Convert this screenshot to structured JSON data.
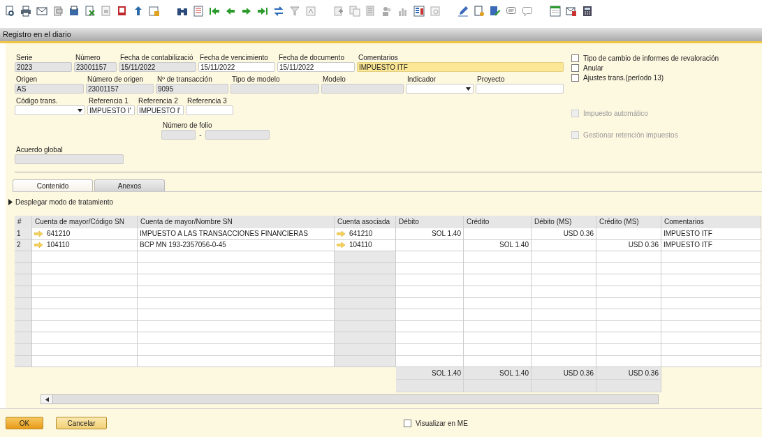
{
  "window": {
    "title": "Registro en el diario"
  },
  "header_rows": [
    [
      {
        "label": "Serie",
        "value": "2023",
        "kind": "readonly"
      },
      {
        "label": "Número",
        "value": "23001157",
        "kind": "readonly"
      },
      {
        "label": "Fecha de contabilizació",
        "value": "15/11/2022",
        "kind": "readonly"
      },
      {
        "label": "Fecha de vencimiento",
        "value": "15/11/2022",
        "kind": "input"
      },
      {
        "label": "Fecha de documento",
        "value": "15/11/2022",
        "kind": "input"
      },
      {
        "label": "Comentarios",
        "value": "IMPUESTO ITF",
        "kind": "highlight"
      }
    ],
    [
      {
        "label": "Origen",
        "value": "AS",
        "kind": "readonly"
      },
      {
        "label": "Número de origen",
        "value": "23001157",
        "kind": "readonly"
      },
      {
        "label": "Nº de transacción",
        "value": "9095",
        "kind": "readonly"
      },
      {
        "label": "Tipo de modelo",
        "kind": "readonly"
      },
      {
        "label": "Modelo",
        "kind": "readonly"
      },
      {
        "label": "Indicador",
        "kind": "dropdown"
      },
      {
        "label": "Proyecto",
        "kind": "input"
      }
    ],
    [
      {
        "label": "Código trans.",
        "kind": "dropdown"
      },
      {
        "label": "Referencia 1",
        "value": "IMPUESTO I'",
        "kind": "input"
      },
      {
        "label": "Referencia 2",
        "value": "IMPUESTO I'",
        "kind": "input"
      },
      {
        "label": "Referencia 3",
        "kind": "input"
      }
    ]
  ],
  "folio": {
    "label": "Número de folio",
    "separator": "-"
  },
  "global_agreement": {
    "label": "Acuerdo global"
  },
  "options": [
    {
      "label": "Tipo de cambio de informes de revaloración",
      "checked": false,
      "disabled": false
    },
    {
      "label": "Anular",
      "checked": false,
      "disabled": false
    },
    {
      "label": "Ajustes trans.(período 13)",
      "checked": false,
      "disabled": false
    }
  ],
  "tax_options": [
    {
      "label": "Impuesto automático",
      "checked": false,
      "disabled": true
    },
    {
      "label": "Gestionar retención impuestos",
      "checked": false,
      "disabled": true
    }
  ],
  "tabs": [
    {
      "label": "Contenido",
      "selected": true
    },
    {
      "label": "Anexos",
      "selected": false
    }
  ],
  "expander": {
    "label": "Desplegar modo de tratamiento",
    "expanded": false
  },
  "table": {
    "columns": [
      {
        "label": "#",
        "kind": "index"
      },
      {
        "label": "Cuenta de mayor/Código SN",
        "kind": "link"
      },
      {
        "label": "Cuenta de mayor/Nombre SN",
        "kind": "text"
      },
      {
        "label": "Cuenta asociada",
        "kind": "link"
      },
      {
        "label": "Débito",
        "kind": "amount"
      },
      {
        "label": "Crédito",
        "kind": "amount"
      },
      {
        "label": "Débito (MS)",
        "kind": "amount"
      },
      {
        "label": "Crédito (MS)",
        "kind": "amount"
      },
      {
        "label": "Comentarios",
        "kind": "text"
      }
    ],
    "rows": [
      [
        "1",
        "641210",
        "IMPUESTO A LAS TRANSACCIONES FINANCIERAS",
        "641210",
        "SOL 1.40",
        null,
        "USD 0.36",
        null,
        "IMPUESTO ITF"
      ],
      [
        "2",
        "104110",
        "BCP MN 193-2357056-0-45",
        "104110",
        null,
        "SOL 1.40",
        null,
        "USD 0.36",
        "IMPUESTO ITF"
      ]
    ],
    "totals": [
      "SOL 1.40",
      "SOL 1.40",
      "USD 0.36",
      "USD 0.36"
    ]
  },
  "buttons": [
    {
      "label": "OK",
      "kind": "primary"
    },
    {
      "label": "Cancelar",
      "kind": "secondary"
    }
  ],
  "display_option": {
    "label": "Visualizar en ME",
    "checked": false
  }
}
